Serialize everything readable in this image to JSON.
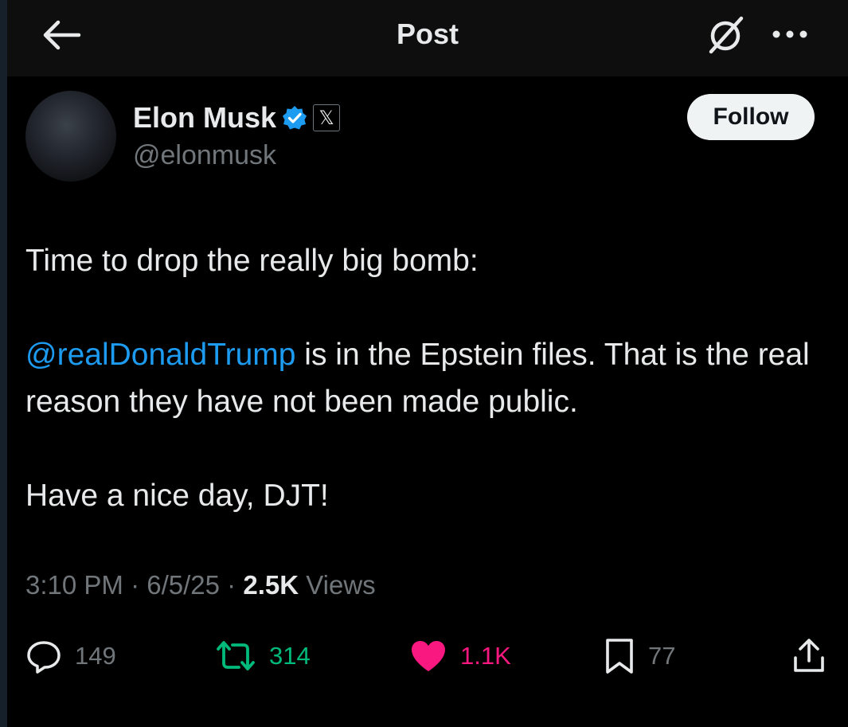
{
  "header": {
    "title": "Post"
  },
  "author": {
    "name": "Elon Musk",
    "handle": "@elonmusk",
    "affiliate_badge": "𝕏",
    "follow_label": "Follow"
  },
  "post": {
    "line1": "Time to drop the really big bomb:",
    "mention": "@realDonaldTrump",
    "line2_rest": " is in the Epstein files. That is the real reason they have not been made public.",
    "line3": "Have a nice day, DJT!",
    "time": "3:10 PM",
    "date": "6/5/25",
    "views_count": "2.5K",
    "views_label": "Views"
  },
  "actions": {
    "replies": "149",
    "reposts": "314",
    "likes": "1.1K",
    "bookmarks": "77"
  },
  "colors": {
    "background": "#000000",
    "text": "#e7e9ea",
    "muted": "#71767b",
    "link": "#1d9bf0",
    "repost_active": "#00ba7c",
    "like_active": "#f91880",
    "verified": "#1d9bf0"
  },
  "icons": [
    "back-arrow-icon",
    "grok-icon",
    "more-icon",
    "verified-badge-icon",
    "reply-icon",
    "repost-icon",
    "like-icon",
    "bookmark-icon",
    "share-icon"
  ]
}
